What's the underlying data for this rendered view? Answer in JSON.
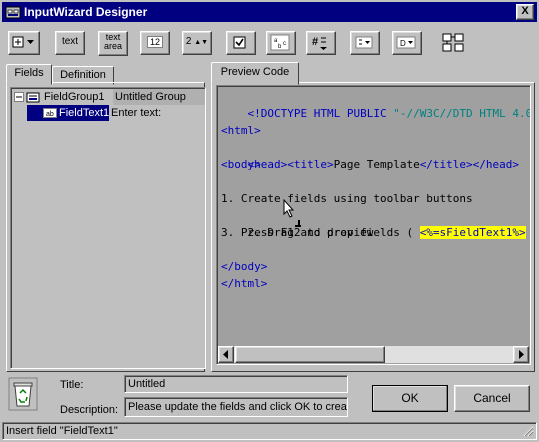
{
  "window": {
    "title": "InputWizard Designer",
    "close_label": "X"
  },
  "toolbar": {
    "text_label": "text",
    "textarea_line1": "text",
    "textarea_line2": "area",
    "number_label": "12",
    "spin_label": "2"
  },
  "left_tabs": [
    "Fields",
    "Definition"
  ],
  "right_tabs": [
    "Preview Code"
  ],
  "tree": {
    "group_name": "FieldGroup1",
    "group_value": "Untitled Group",
    "field_name": "FieldText1",
    "field_value": "Enter text:"
  },
  "code": {
    "doctype_a": "<!DOCTYPE HTML PUBLIC ",
    "doctype_b": "\"-//W3C//DTD HTML 4.0 ",
    "html_open": "<html>",
    "head_open": "<head><title>",
    "title_text": "Page Template",
    "head_close": "</title></head>",
    "body_open": "<body>",
    "line1": "1. Create fields using toolbar buttons",
    "line2a": "2. Drag and drop fields ( ",
    "line2_field": "<%=sFieldText1%>",
    "line2b": " )",
    "line3": "3. Press F12 to preview",
    "body_close": "</body>",
    "html_close": "</html>"
  },
  "form": {
    "title_label": "Title:",
    "title_value": "Untitled",
    "desc_label": "Description:",
    "desc_value": "Please update the fields and click OK to creat"
  },
  "buttons": {
    "ok": "OK",
    "cancel": "Cancel"
  },
  "status": "Insert field \"FieldText1\""
}
